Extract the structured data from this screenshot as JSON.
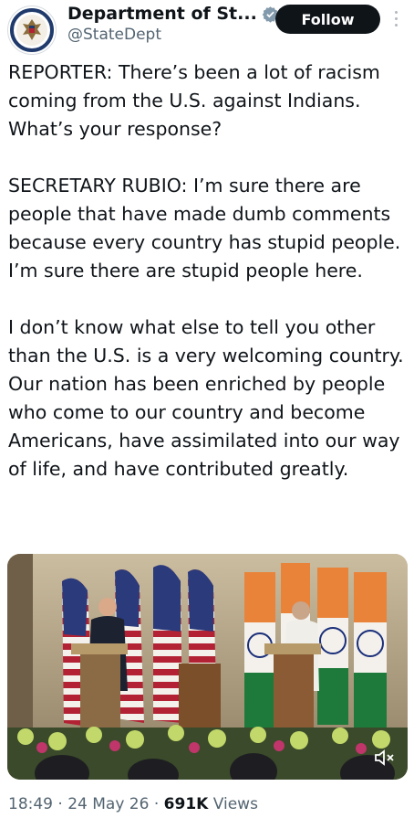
{
  "account": {
    "display_name": "Department of St...",
    "handle": "@StateDept",
    "verified_icon": "verified-badge-icon",
    "avatar_icon": "state-department-seal-icon"
  },
  "actions": {
    "follow_label": "Follow",
    "more_icon": "more-vertical-icon"
  },
  "tweet": {
    "paragraphs": [
      "REPORTER: There’s been a lot of racism coming from the U.S. against Indians. What’s your response?",
      "SECRETARY RUBIO: I’m sure there are people that have made dumb comments because every country has stupid people. I’m sure there are stupid people here.",
      "I don’t know what else to tell you other than the U.S. is a very welcoming country. Our nation has been enriched by people who come to our country and become Americans, have assimilated into our way of life, and have contributed greatly."
    ]
  },
  "media": {
    "description_icon": "press-conference-image",
    "mute_icon": "muted-speaker-icon"
  },
  "meta": {
    "time": "18:49",
    "sep1": " · ",
    "date": "24 May 26",
    "sep2": " · ",
    "views_count": "691K",
    "views_label": " Views"
  },
  "colors": {
    "text": "#0f1419",
    "secondary": "#536471",
    "follow_bg": "#0f1419",
    "verified": "#829aab"
  }
}
